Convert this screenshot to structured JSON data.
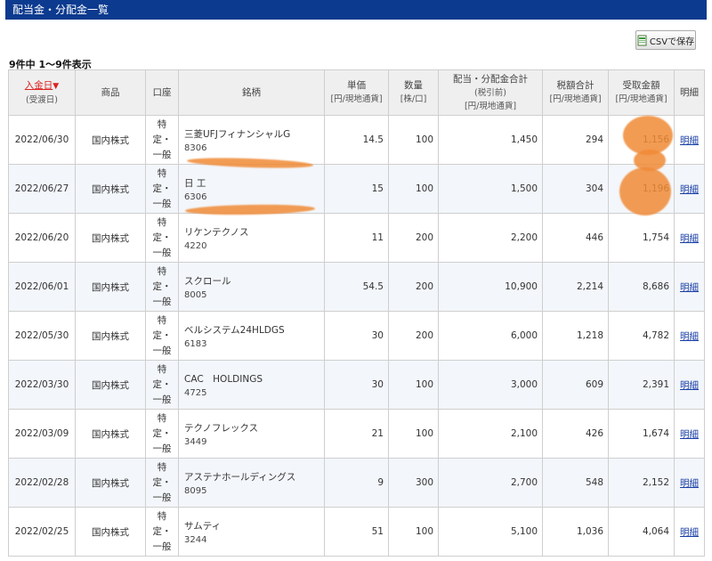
{
  "page": {
    "title": "配当金・分配金一覧"
  },
  "toolbar": {
    "csv_label": "CSVで保存"
  },
  "summary": {
    "count_text": "9件中 1〜9件表示"
  },
  "table": {
    "headers": {
      "date": "入金日",
      "date_sort": "▼",
      "date_sub": "(受渡日)",
      "product": "商品",
      "account": "口座",
      "name": "銘柄",
      "unit_price": "単価",
      "unit_price_sub": "[円/現地通貨]",
      "quantity": "数量",
      "quantity_sub": "[株/口]",
      "total": "配当・分配金合計",
      "total_sub1": "(税引前)",
      "total_sub2": "[円/現地通貨]",
      "tax": "税額合計",
      "tax_sub": "[円/現地通貨]",
      "received": "受取金額",
      "received_sub": "[円/現地通貨]",
      "detail": "明細"
    },
    "rows": [
      {
        "date": "2022/06/30",
        "product": "国内株式",
        "acct1": "特",
        "acct2": "定・",
        "acct3": "一般",
        "name": "三菱UFJフィナンシャルG",
        "code": "8306",
        "unit": "14.5",
        "qty": "100",
        "total": "1,450",
        "tax": "294",
        "received": "1,156",
        "detail": "明細"
      },
      {
        "date": "2022/06/27",
        "product": "国内株式",
        "acct1": "特",
        "acct2": "定・",
        "acct3": "一般",
        "name": "日 工",
        "code": "6306",
        "unit": "15",
        "qty": "100",
        "total": "1,500",
        "tax": "304",
        "received": "1,196",
        "detail": "明細"
      },
      {
        "date": "2022/06/20",
        "product": "国内株式",
        "acct1": "特",
        "acct2": "定・",
        "acct3": "一般",
        "name": "リケンテクノス",
        "code": "4220",
        "unit": "11",
        "qty": "200",
        "total": "2,200",
        "tax": "446",
        "received": "1,754",
        "detail": "明細"
      },
      {
        "date": "2022/06/01",
        "product": "国内株式",
        "acct1": "特",
        "acct2": "定・",
        "acct3": "一般",
        "name": "スクロール",
        "code": "8005",
        "unit": "54.5",
        "qty": "200",
        "total": "10,900",
        "tax": "2,214",
        "received": "8,686",
        "detail": "明細"
      },
      {
        "date": "2022/05/30",
        "product": "国内株式",
        "acct1": "特",
        "acct2": "定・",
        "acct3": "一般",
        "name": "ベルシステム24HLDGS",
        "code": "6183",
        "unit": "30",
        "qty": "200",
        "total": "6,000",
        "tax": "1,218",
        "received": "4,782",
        "detail": "明細"
      },
      {
        "date": "2022/03/30",
        "product": "国内株式",
        "acct1": "特",
        "acct2": "定・",
        "acct3": "一般",
        "name": "CAC　HOLDINGS",
        "code": "4725",
        "unit": "30",
        "qty": "100",
        "total": "3,000",
        "tax": "609",
        "received": "2,391",
        "detail": "明細"
      },
      {
        "date": "2022/03/09",
        "product": "国内株式",
        "acct1": "特",
        "acct2": "定・",
        "acct3": "一般",
        "name": "テクノフレックス",
        "code": "3449",
        "unit": "21",
        "qty": "100",
        "total": "2,100",
        "tax": "426",
        "received": "1,674",
        "detail": "明細"
      },
      {
        "date": "2022/02/28",
        "product": "国内株式",
        "acct1": "特",
        "acct2": "定・",
        "acct3": "一般",
        "name": "アステナホールディングス",
        "code": "8095",
        "unit": "9",
        "qty": "300",
        "total": "2,700",
        "tax": "548",
        "received": "2,152",
        "detail": "明細"
      },
      {
        "date": "2022/02/25",
        "product": "国内株式",
        "acct1": "特",
        "acct2": "定・",
        "acct3": "一般",
        "name": "サムティ",
        "code": "3244",
        "unit": "51",
        "qty": "100",
        "total": "5,100",
        "tax": "1,036",
        "received": "4,064",
        "detail": "明細"
      }
    ]
  },
  "colors": {
    "title_bar": "#0b3a8f",
    "sort_link": "#dd2222",
    "detail_link": "#1a3fa6",
    "redaction": "#f08a36"
  }
}
